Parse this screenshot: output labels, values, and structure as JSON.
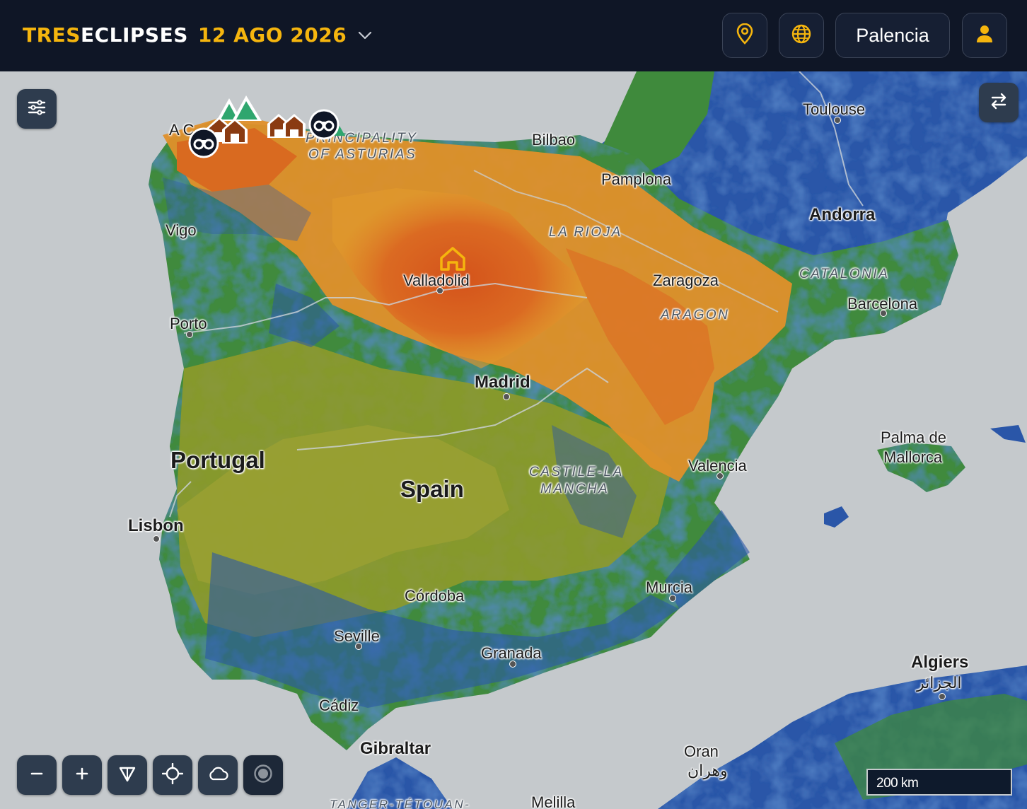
{
  "header": {
    "brand_part1": "TRES",
    "brand_part2": "ECLIPSES",
    "date": "12 AGO 2026",
    "location_button": "Palencia"
  },
  "icons": {
    "date_dropdown": "chevron-down-icon",
    "location": "map-pin-icon",
    "globe": "globe-icon",
    "user": "user-icon",
    "layers": "sliders-icon",
    "swap": "swap-arrows-icon",
    "zoom_out": "minus-icon",
    "zoom_in": "plus-icon",
    "compass": "compass-triangle-icon",
    "locate": "crosshair-icon",
    "clouds": "cloud-icon",
    "record": "record-icon"
  },
  "map": {
    "cities": [
      "A C",
      "Bilbao",
      "Pamplona",
      "Toulouse",
      "Vigo",
      "Valladolid",
      "Zaragoza",
      "Porto",
      "Barcelona",
      "Valencia",
      "Palma de",
      "Mallorca",
      "Lisbon",
      "Córdoba",
      "Murcia",
      "Seville",
      "Granada",
      "Cádiz",
      "Oran",
      "وهران",
      "Melilla",
      "الجزائر"
    ],
    "capitals": [
      "Andorra",
      "Madrid",
      "Gibraltar",
      "Algiers"
    ],
    "countries": [
      "Portugal",
      "Spain"
    ],
    "regions": [
      "PRINCIPALITY",
      "OF ASTURIAS",
      "LA RIOJA",
      "CATALONIA",
      "ARAGON",
      "CASTILE-LA",
      "MANCHA",
      "TANGER-TÉTOUAN-"
    ],
    "scale": "200 km"
  },
  "colors": {
    "header_bg": "#0f1626",
    "accent": "#f5b50e",
    "sea": "#c5c9cc",
    "high_zone": "#d9581c",
    "mid_zone": "#e0902a",
    "olive": "#8e9a2a",
    "green": "#3f8a3c",
    "blue": "#2a56a8"
  }
}
